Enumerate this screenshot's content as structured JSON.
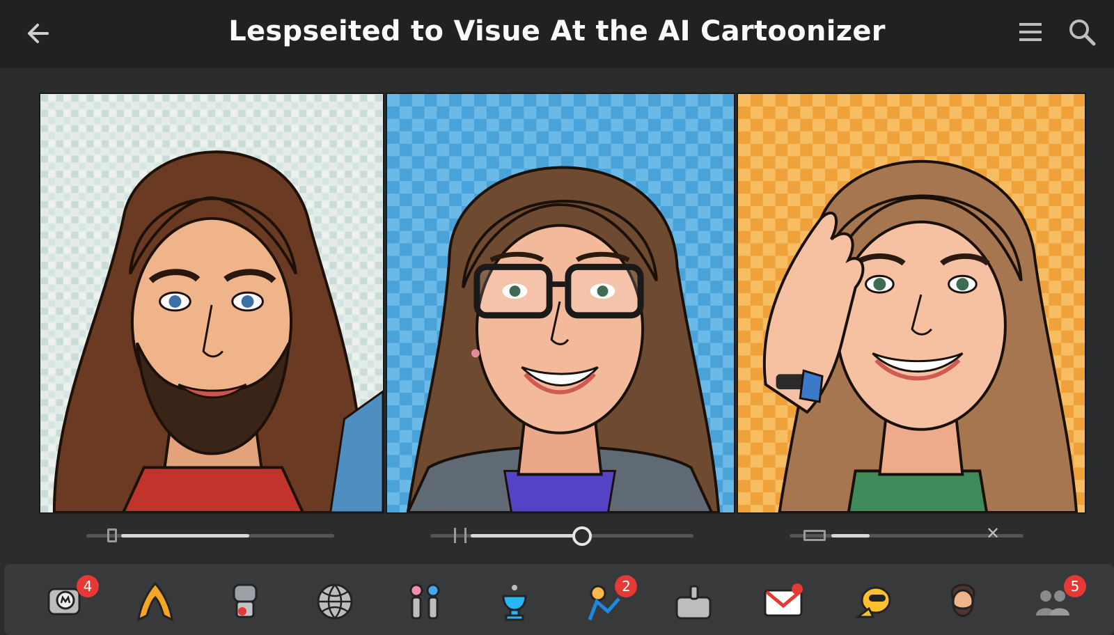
{
  "header": {
    "title": "Lespseited to Visue At the AI Cartoonizer",
    "back_icon": "arrow-left-icon",
    "menu_icon": "hamburger-menu-icon",
    "search_icon": "search-icon"
  },
  "panels": [
    {
      "name": "cartoon-portrait-bearded-man",
      "background": "mosaic-light"
    },
    {
      "name": "cartoon-portrait-woman-glasses",
      "background": "checker-blue"
    },
    {
      "name": "cartoon-portrait-woman-hand",
      "background": "checker-orange"
    }
  ],
  "sliders": [
    {
      "name": "slider-1",
      "value": 0.6
    },
    {
      "name": "slider-2",
      "value": 0.5
    },
    {
      "name": "slider-3",
      "value": 0.2
    }
  ],
  "dock": {
    "items": [
      {
        "name": "dock-item-chat-app",
        "icon": "chat-bubble-icon",
        "badge": "4"
      },
      {
        "name": "dock-item-arch-app",
        "icon": "arch-logo-icon",
        "badge": ""
      },
      {
        "name": "dock-item-robot-app",
        "icon": "robot-icon",
        "badge": ""
      },
      {
        "name": "dock-item-globe-app",
        "icon": "globe-icon",
        "badge": ""
      },
      {
        "name": "dock-item-figures-app",
        "icon": "figures-icon",
        "badge": ""
      },
      {
        "name": "dock-item-trophy-app",
        "icon": "trophy-icon",
        "badge": ""
      },
      {
        "name": "dock-item-character-app",
        "icon": "character-icon",
        "badge": "2"
      },
      {
        "name": "dock-item-thumbs-app",
        "icon": "thumbs-up-icon",
        "badge": ""
      },
      {
        "name": "dock-item-mail-app",
        "icon": "mail-icon",
        "badge": ""
      },
      {
        "name": "dock-item-mascot-app",
        "icon": "mascot-icon",
        "badge": ""
      },
      {
        "name": "dock-item-avatar-app",
        "icon": "bearded-avatar-icon",
        "badge": ""
      },
      {
        "name": "dock-item-people-app",
        "icon": "people-icon",
        "badge": "5"
      }
    ]
  },
  "colors": {
    "topbar": "#202123",
    "background": "#2b2c2e",
    "dock": "#38393b",
    "badge": "#e53935",
    "panel2_bg": "#4aa3d8",
    "panel3_bg": "#f0a23a"
  }
}
